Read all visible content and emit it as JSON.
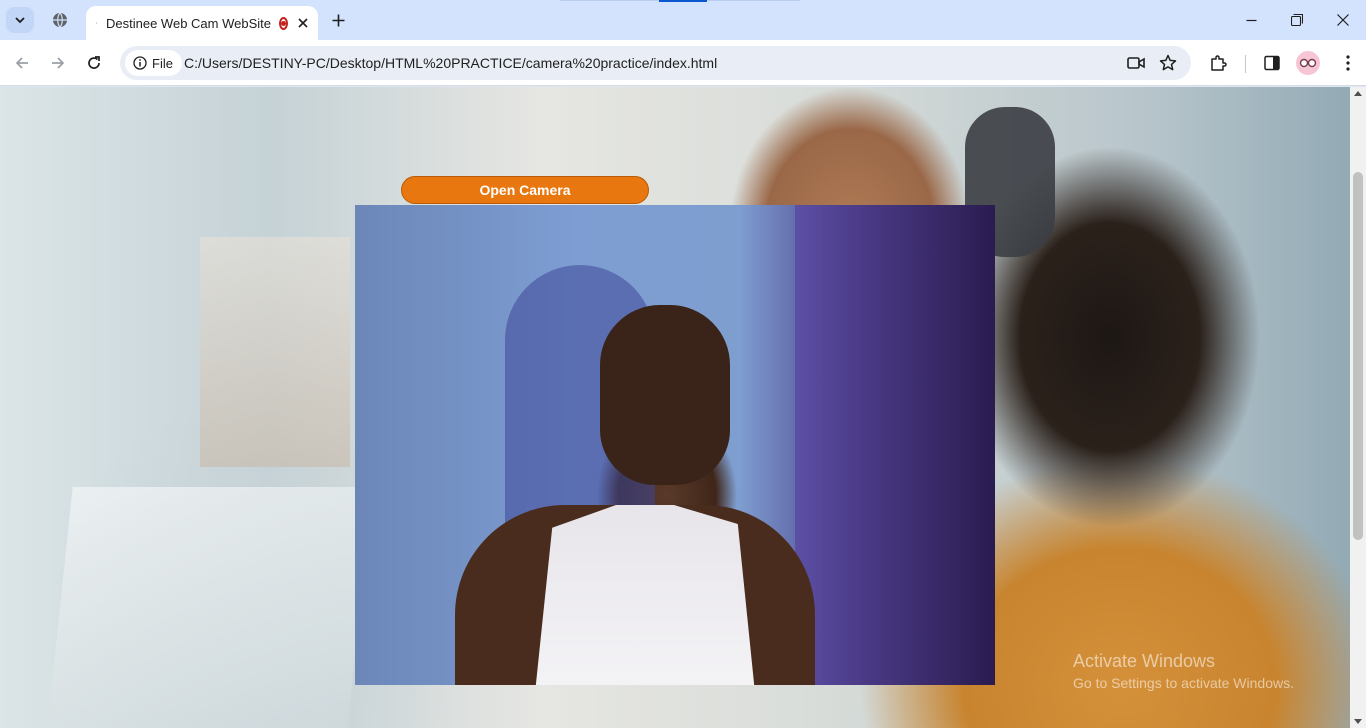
{
  "browser": {
    "tab": {
      "title": "Destinee Web Cam WebSite"
    },
    "address": {
      "scheme_label": "File",
      "url": "C:/Users/DESTINY-PC/Desktop/HTML%20PRACTICE/camera%20practice/index.html"
    }
  },
  "page": {
    "open_camera_label": "Open Camera"
  },
  "watermark": {
    "title": "Activate Windows",
    "subtitle": "Go to Settings to activate Windows."
  },
  "colors": {
    "button": "#e8770f",
    "tabstrip": "#d3e3fd",
    "recording": "#c5221f"
  },
  "icons": [
    "tab-search-icon",
    "globe-icon",
    "recording-icon",
    "close-icon",
    "plus-icon",
    "minimize-icon",
    "restore-icon",
    "back-arrow-icon",
    "forward-arrow-icon",
    "reload-icon",
    "info-icon",
    "camera-icon",
    "star-icon",
    "extensions-icon",
    "side-panel-icon",
    "profile-avatar-icon",
    "kebab-menu-icon"
  ]
}
